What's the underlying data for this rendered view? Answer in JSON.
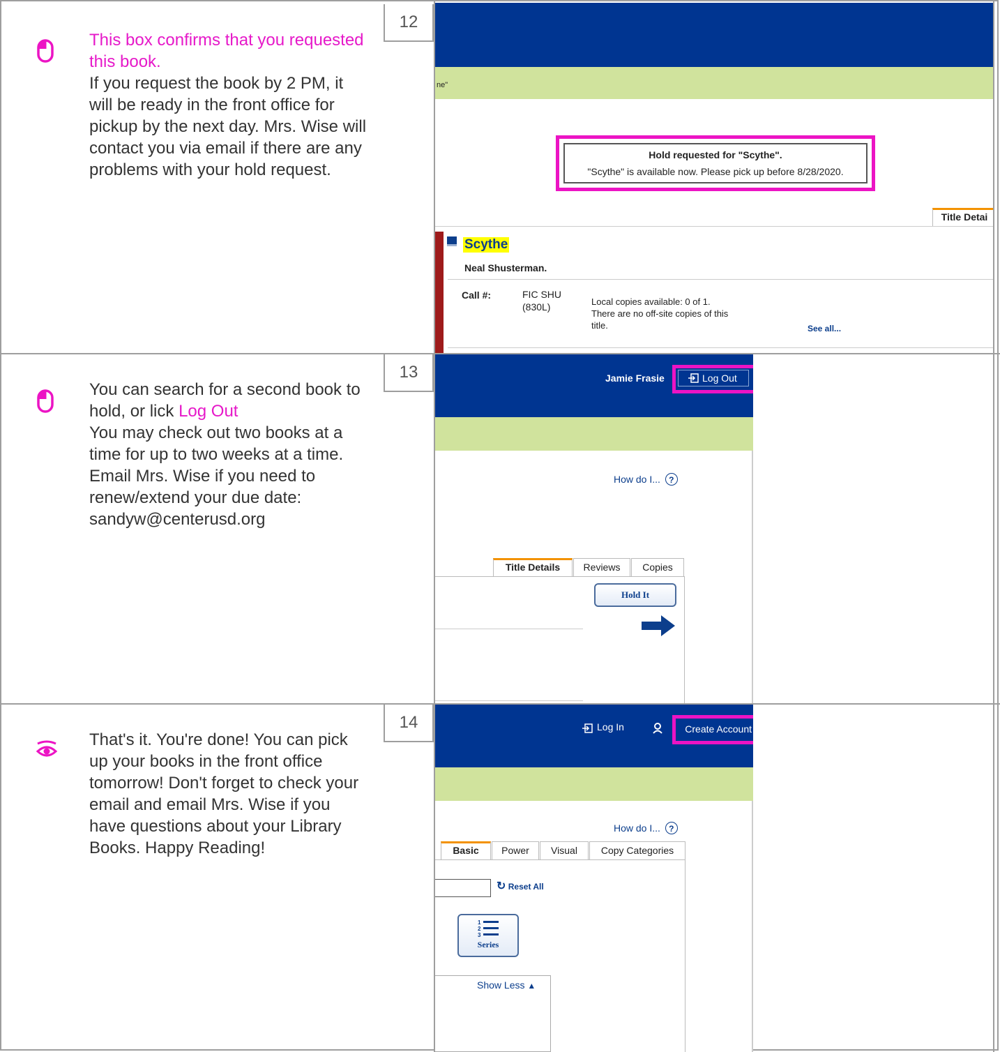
{
  "colors": {
    "navy": "#003591",
    "green": "#d0e39d",
    "accent": "#ec14c4",
    "link": "#0c3e8c"
  },
  "steps": [
    {
      "number": "12",
      "icon": "mouse-icon",
      "text_highlight": "This box confirms that you requested this book.",
      "text_rest": "If you request the book by 2 PM, it will be ready in the front office for pickup by the next day. Mrs. Wise will contact you via email if there are any problems with your hold request.",
      "screenshot": {
        "breadcrumb_fragment": "ne\"",
        "alert_title": "Hold requested for \"Scythe\".",
        "alert_message": "\"Scythe\" is available now. Please pick up before 8/28/2020.",
        "tab_label": "Title Detai",
        "book_title": "Scythe",
        "author": "Neal Shusterman.",
        "call_label": "Call #:",
        "call_number_line1": "FIC SHU",
        "call_number_line2": "(830L)",
        "availability_line1": "Local copies available: 0 of 1.",
        "availability_line2": "There are no off-site copies of this",
        "availability_line3": "title.",
        "see_all": "See all..."
      }
    },
    {
      "number": "13",
      "icon": "mouse-icon",
      "text_before": "You can search for a second book to hold, or lick ",
      "text_highlight": "Log Out",
      "text_rest": "You may check out two books at a time for up to two weeks at a time. Email Mrs. Wise if you need to renew/extend your due date: sandyw@centerusd.org",
      "screenshot": {
        "user_name": "Jamie Frasie",
        "logout_label": "Log Out",
        "help_link": "How do I...",
        "tabs": [
          "Title Details",
          "Reviews",
          "Copies"
        ],
        "hold_button": "Hold It"
      }
    },
    {
      "number": "14",
      "icon": "eye-icon",
      "text_rest": "That's it. You're done! You can pick up your books in the front office tomorrow! Don't forget to check your email and email Mrs. Wise if you have questions about your Library Books. Happy Reading!",
      "screenshot": {
        "login_label": "Log In",
        "create_account_label": "Create Account",
        "help_link": "How do I...",
        "tabs": [
          "Basic",
          "Power",
          "Visual",
          "Copy Categories"
        ],
        "reset_label": "Reset All",
        "series_label": "Series",
        "show_less": "Show Less"
      }
    }
  ]
}
